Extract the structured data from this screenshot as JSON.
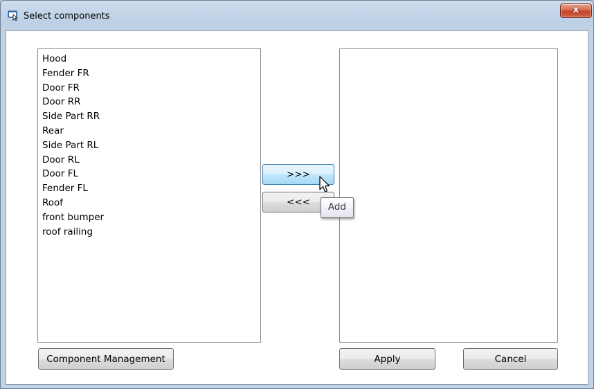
{
  "window": {
    "title": "Select components",
    "close_label": "x",
    "title_icon": "dialog-window-icon"
  },
  "available_list": {
    "items": [
      "Hood",
      "Fender FR",
      "Door FR",
      "Door RR",
      "Side Part RR",
      "Rear",
      "Side Part RL",
      "Door RL",
      "Door FL",
      "Fender FL",
      "Roof",
      "front bumper",
      "roof railing"
    ]
  },
  "selected_list": {
    "items": []
  },
  "buttons": {
    "add_label": ">>>",
    "remove_label": "<<<",
    "component_management_label": "Component Management",
    "apply_label": "Apply",
    "cancel_label": "Cancel"
  },
  "tooltip": {
    "text": "Add"
  },
  "colors": {
    "close_button": "#c4432a",
    "hover_button": "#bee6fd",
    "titlebar": "#cfdceb"
  }
}
